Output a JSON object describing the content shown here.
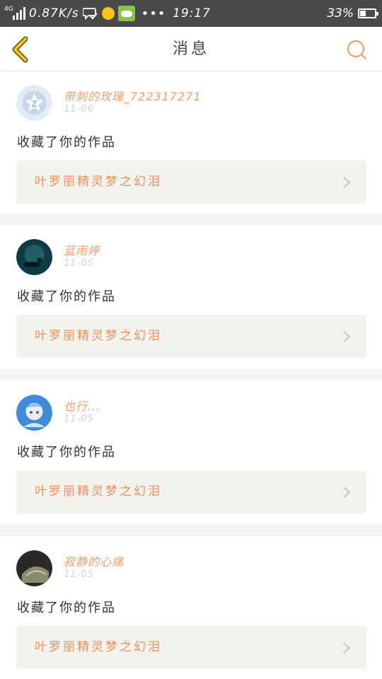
{
  "status_bar": {
    "network": "4G",
    "speed": "0.87K/s",
    "more": "•••",
    "time": "19:17",
    "battery": "33%",
    "icons": [
      "signal-icon",
      "wechat-icon",
      "coin-icon",
      "game-icon",
      "battery-icon"
    ]
  },
  "header": {
    "title": "消息",
    "back_icon": "chevron-left-icon",
    "search_icon": "search-icon",
    "accent": "#f5c518"
  },
  "messages": [
    {
      "name": "带刺的玫瑰_722317271",
      "date": "11-06",
      "action": "收藏了你的作品",
      "work": "叶罗丽精灵梦之幻泪"
    },
    {
      "name": "蓝雨婷",
      "date": "11-05",
      "action": "收藏了你的作品",
      "work": "叶罗丽精灵梦之幻泪"
    },
    {
      "name": "也行...",
      "date": "11-05",
      "action": "收藏了你的作品",
      "work": "叶罗丽精灵梦之幻泪"
    },
    {
      "name": "寂静的心痛",
      "date": "11-05",
      "action": "收藏了你的作品",
      "work": "叶罗丽精灵梦之幻泪"
    }
  ],
  "colors": {
    "name": "#f0a070",
    "work_title": "#f09060",
    "card_bg": "#f3f2ec",
    "status_bar": "#4a4a4a"
  }
}
